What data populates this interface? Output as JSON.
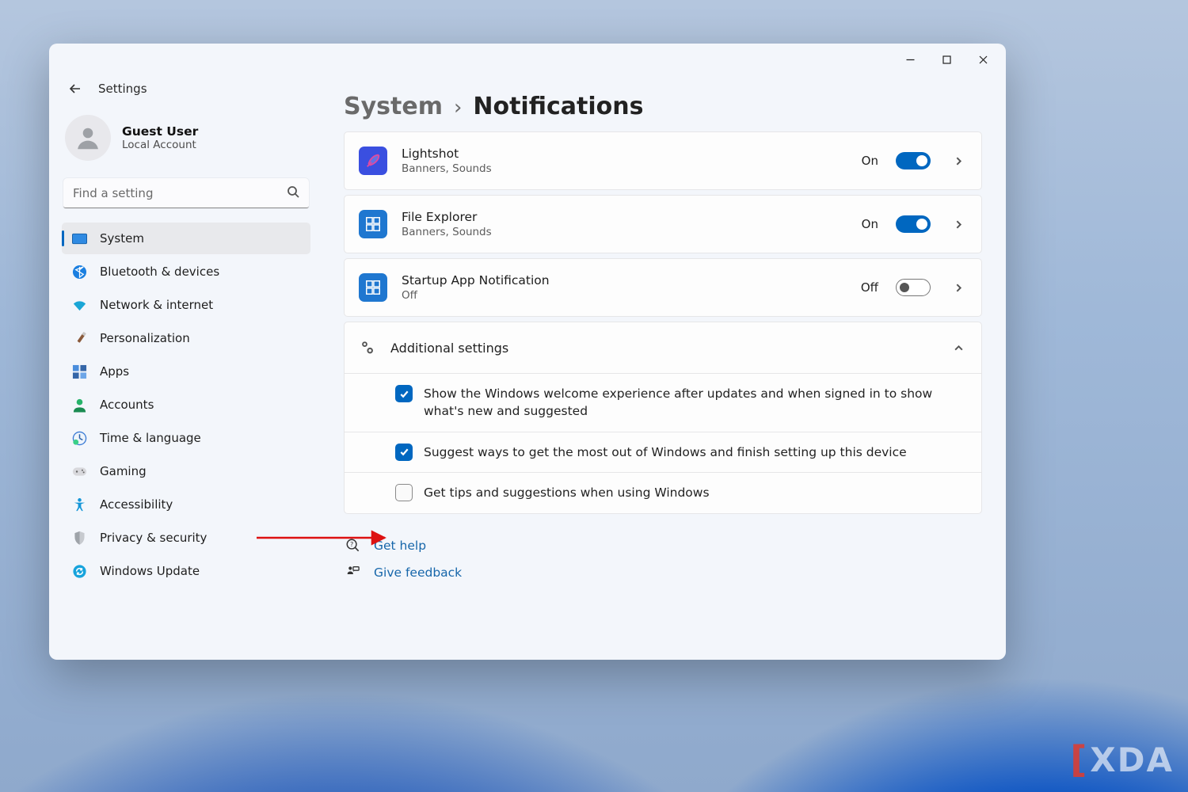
{
  "window": {
    "title": "Settings"
  },
  "user": {
    "name": "Guest User",
    "account": "Local Account"
  },
  "search": {
    "placeholder": "Find a setting"
  },
  "sidebar": {
    "items": [
      {
        "id": "system",
        "label": "System",
        "selected": true
      },
      {
        "id": "bluetooth",
        "label": "Bluetooth & devices"
      },
      {
        "id": "network",
        "label": "Network & internet"
      },
      {
        "id": "personalization",
        "label": "Personalization"
      },
      {
        "id": "apps",
        "label": "Apps"
      },
      {
        "id": "accounts",
        "label": "Accounts"
      },
      {
        "id": "time",
        "label": "Time & language"
      },
      {
        "id": "gaming",
        "label": "Gaming"
      },
      {
        "id": "accessibility",
        "label": "Accessibility"
      },
      {
        "id": "privacy",
        "label": "Privacy & security"
      },
      {
        "id": "update",
        "label": "Windows Update"
      }
    ]
  },
  "breadcrumb": {
    "parent": "System",
    "separator": "›",
    "current": "Notifications"
  },
  "apps": [
    {
      "id": "lightshot",
      "name": "Lightshot",
      "sub": "Banners, Sounds",
      "state": "On",
      "on": true,
      "icon_bg": "#3a4fe0",
      "icon": "feather"
    },
    {
      "id": "file-explorer",
      "name": "File Explorer",
      "sub": "Banners, Sounds",
      "state": "On",
      "on": true,
      "icon_bg": "#1f77d0",
      "icon": "explorer"
    },
    {
      "id": "startup",
      "name": "Startup App Notification",
      "sub": "Off",
      "state": "Off",
      "on": false,
      "icon_bg": "#1f77d0",
      "icon": "explorer"
    }
  ],
  "additional": {
    "title": "Additional settings",
    "expanded": true,
    "items": [
      {
        "id": "welcome",
        "checked": true,
        "label": "Show the Windows welcome experience after updates and when signed in to show what's new and suggested"
      },
      {
        "id": "suggest",
        "checked": true,
        "label": "Suggest ways to get the most out of Windows and finish setting up this device"
      },
      {
        "id": "tips",
        "checked": false,
        "label": "Get tips and suggestions when using Windows"
      }
    ]
  },
  "footer": {
    "help": "Get help",
    "feedback": "Give feedback"
  },
  "watermark": "XDA"
}
